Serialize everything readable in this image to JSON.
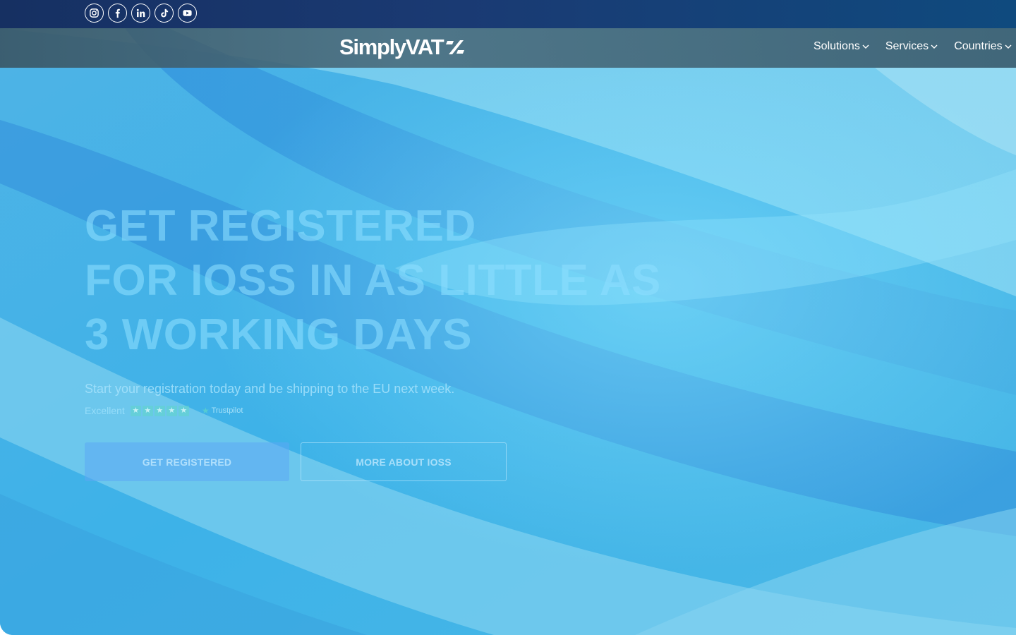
{
  "header": {
    "social_icons": [
      "instagram-icon",
      "facebook-icon",
      "linkedin-icon",
      "tiktok-icon",
      "youtube-icon"
    ],
    "logo_text": "SimplyVAT",
    "nav": [
      {
        "label": "Solutions"
      },
      {
        "label": "Services"
      },
      {
        "label": "Countries"
      }
    ]
  },
  "hero": {
    "title_lines": [
      "GET REGISTERED",
      "FOR IOSS IN AS LITTLE AS",
      "3 WORKING DAYS"
    ],
    "subtitle": "Start your registration today and be shipping to the EU next week.",
    "trust": {
      "rating_label": "Excellent",
      "stars": 5,
      "brand": "Trustpilot"
    },
    "primary_button": "GET REGISTERED",
    "secondary_button": "MORE ABOUT IOSS"
  },
  "colors": {
    "top_bar": "#163062",
    "hero_base": "#41b4e6",
    "text": "#ffffff"
  }
}
